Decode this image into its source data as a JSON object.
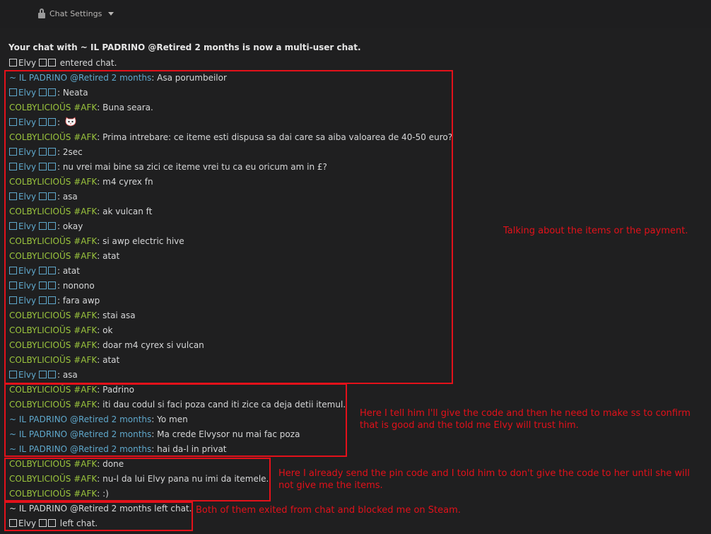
{
  "top": {
    "chat_settings": "Chat Settings"
  },
  "header": "Your chat with ~ IL PADRINO @Retired 2 months is now a multi-user chat.",
  "names": {
    "elvy": "Elvy",
    "padrino": "~ IL PADRINO @Retired 2 months",
    "colby": "COLBYLICIOŬS #AFK"
  },
  "lines": [
    {
      "type": "sys",
      "who": "elvy",
      "text": "entered chat."
    },
    {
      "type": "msg",
      "who": "padrino",
      "text": "Asa porumbeilor"
    },
    {
      "type": "msg",
      "who": "elvy",
      "text": "Neata"
    },
    {
      "type": "msg",
      "who": "colby",
      "text": "Buna seara."
    },
    {
      "type": "emoji",
      "who": "elvy",
      "text": ""
    },
    {
      "type": "msg",
      "who": "colby",
      "text": "Prima intrebare: ce iteme esti dispusa sa dai care sa aiba valoarea de 40-50 euro?"
    },
    {
      "type": "msg",
      "who": "elvy",
      "text": "2sec"
    },
    {
      "type": "msg",
      "who": "elvy",
      "text": "nu vrei mai bine sa zici ce iteme vrei tu ca eu oricum am in £?"
    },
    {
      "type": "msg",
      "who": "colby",
      "text": "m4 cyrex fn"
    },
    {
      "type": "msg",
      "who": "elvy",
      "text": "asa"
    },
    {
      "type": "msg",
      "who": "colby",
      "text": "ak vulcan ft"
    },
    {
      "type": "msg",
      "who": "elvy",
      "text": "okay"
    },
    {
      "type": "msg",
      "who": "colby",
      "text": "si awp electric hive"
    },
    {
      "type": "msg",
      "who": "colby",
      "text": "atat"
    },
    {
      "type": "msg",
      "who": "elvy",
      "text": "atat"
    },
    {
      "type": "msg",
      "who": "elvy",
      "text": "nonono"
    },
    {
      "type": "msg",
      "who": "elvy",
      "text": "fara awp"
    },
    {
      "type": "msg",
      "who": "colby",
      "text": "stai asa"
    },
    {
      "type": "msg",
      "who": "colby",
      "text": "ok"
    },
    {
      "type": "msg",
      "who": "colby",
      "text": "doar m4 cyrex si vulcan"
    },
    {
      "type": "msg",
      "who": "colby",
      "text": "atat"
    },
    {
      "type": "msg",
      "who": "elvy",
      "text": "asa"
    },
    {
      "type": "msg",
      "who": "colby",
      "text": "Padrino"
    },
    {
      "type": "msg",
      "who": "colby",
      "text": "iti dau codul si faci poza cand iti zice ca deja detii itemul."
    },
    {
      "type": "msg",
      "who": "padrino",
      "text": "Yo men"
    },
    {
      "type": "msg",
      "who": "padrino",
      "text": "Ma crede Elvysor nu mai fac poza"
    },
    {
      "type": "msg",
      "who": "padrino",
      "text": "hai da-l in privat"
    },
    {
      "type": "msg",
      "who": "colby",
      "text": "done"
    },
    {
      "type": "msg",
      "who": "colby",
      "text": "nu-l da lui Elvy pana nu imi da itemele."
    },
    {
      "type": "msg",
      "who": "colby",
      "text": ":)"
    },
    {
      "type": "sys",
      "who": "padrino",
      "text": "left chat."
    },
    {
      "type": "sys",
      "who": "elvy",
      "text": "left chat."
    }
  ],
  "annotations": [
    "Talking about the items or the payment.",
    "Here I tell him I'll give the code and then he need to make ss to confirm that is good and the told me Elvy will trust him.",
    "Here I already send the pin code and I told him to don't give the code to her until she will not give me the items.",
    "Both of them exited from chat and blocked me on Steam."
  ],
  "colors": {
    "annotation_red": "#e3111a",
    "elvy_blue": "#5fa8cc",
    "colby_green": "#9bc53d"
  }
}
